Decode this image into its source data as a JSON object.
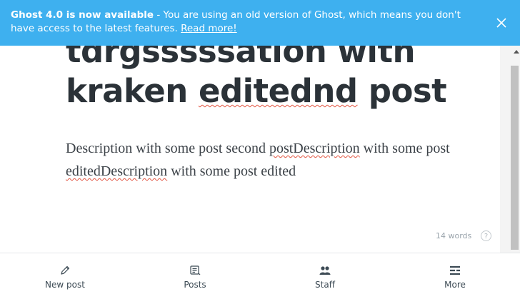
{
  "notice": {
    "bold": "Ghost 4.0 is now available",
    "text": " - You are using an old version of Ghost, which means you don't have access to the latest features. ",
    "link": "Read more!"
  },
  "editor": {
    "title_line1": "tdrgsssssation with",
    "title_line2_a": "kraken",
    "title_line2_b": "editednd",
    "title_line2_c": "post",
    "body": {
      "a": "Description with some post second ",
      "b": "postDescription",
      "c": " with some post ",
      "d": "editedDescription",
      "e": " with some post edited"
    }
  },
  "word_count": "14 words",
  "help": "?",
  "tabs": [
    {
      "label": "New post",
      "icon": "pencil-icon"
    },
    {
      "label": "Posts",
      "icon": "posts-icon"
    },
    {
      "label": "Staff",
      "icon": "staff-icon"
    },
    {
      "label": "More",
      "icon": "more-icon"
    }
  ],
  "colors": {
    "notice_bg": "#3eb0ef",
    "title": "#2b3238",
    "spellcheck": "#e25440"
  }
}
